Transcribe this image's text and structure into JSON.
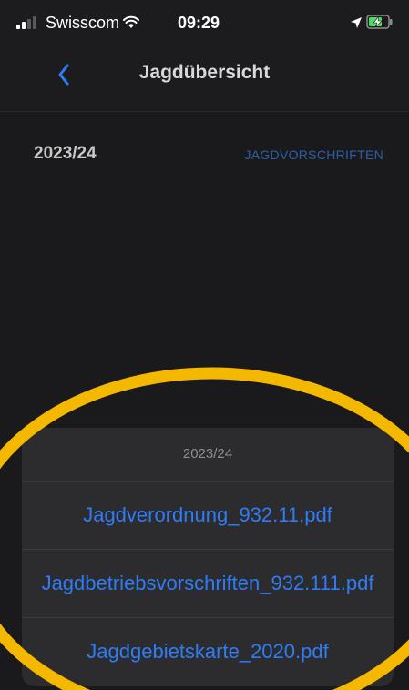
{
  "status_bar": {
    "carrier": "Swisscom",
    "time": "09:29",
    "signal_icon": "signal-bars-icon",
    "wifi_icon": "wifi-icon",
    "location_icon": "location-arrow-icon",
    "battery_icon": "battery-charging-icon"
  },
  "nav": {
    "title": "Jagdübersicht",
    "back_icon": "chevron-left-icon"
  },
  "content": {
    "season": "2023/24",
    "rules_link": "JAGDVORSCHRIFTEN"
  },
  "action_sheet": {
    "title": "2023/24",
    "options": [
      "Jagdverordnung_932.11.pdf",
      "Jagdbetriebsvorschriften_932.111.pdf",
      "Jagdgebietskarte_2020.pdf"
    ]
  },
  "colors": {
    "accent": "#2f7cf6",
    "link_dim": "#2c5fa8",
    "highlight": "#f5b800",
    "background": "#1a1a1c",
    "sheet": "#2c2c2e"
  }
}
